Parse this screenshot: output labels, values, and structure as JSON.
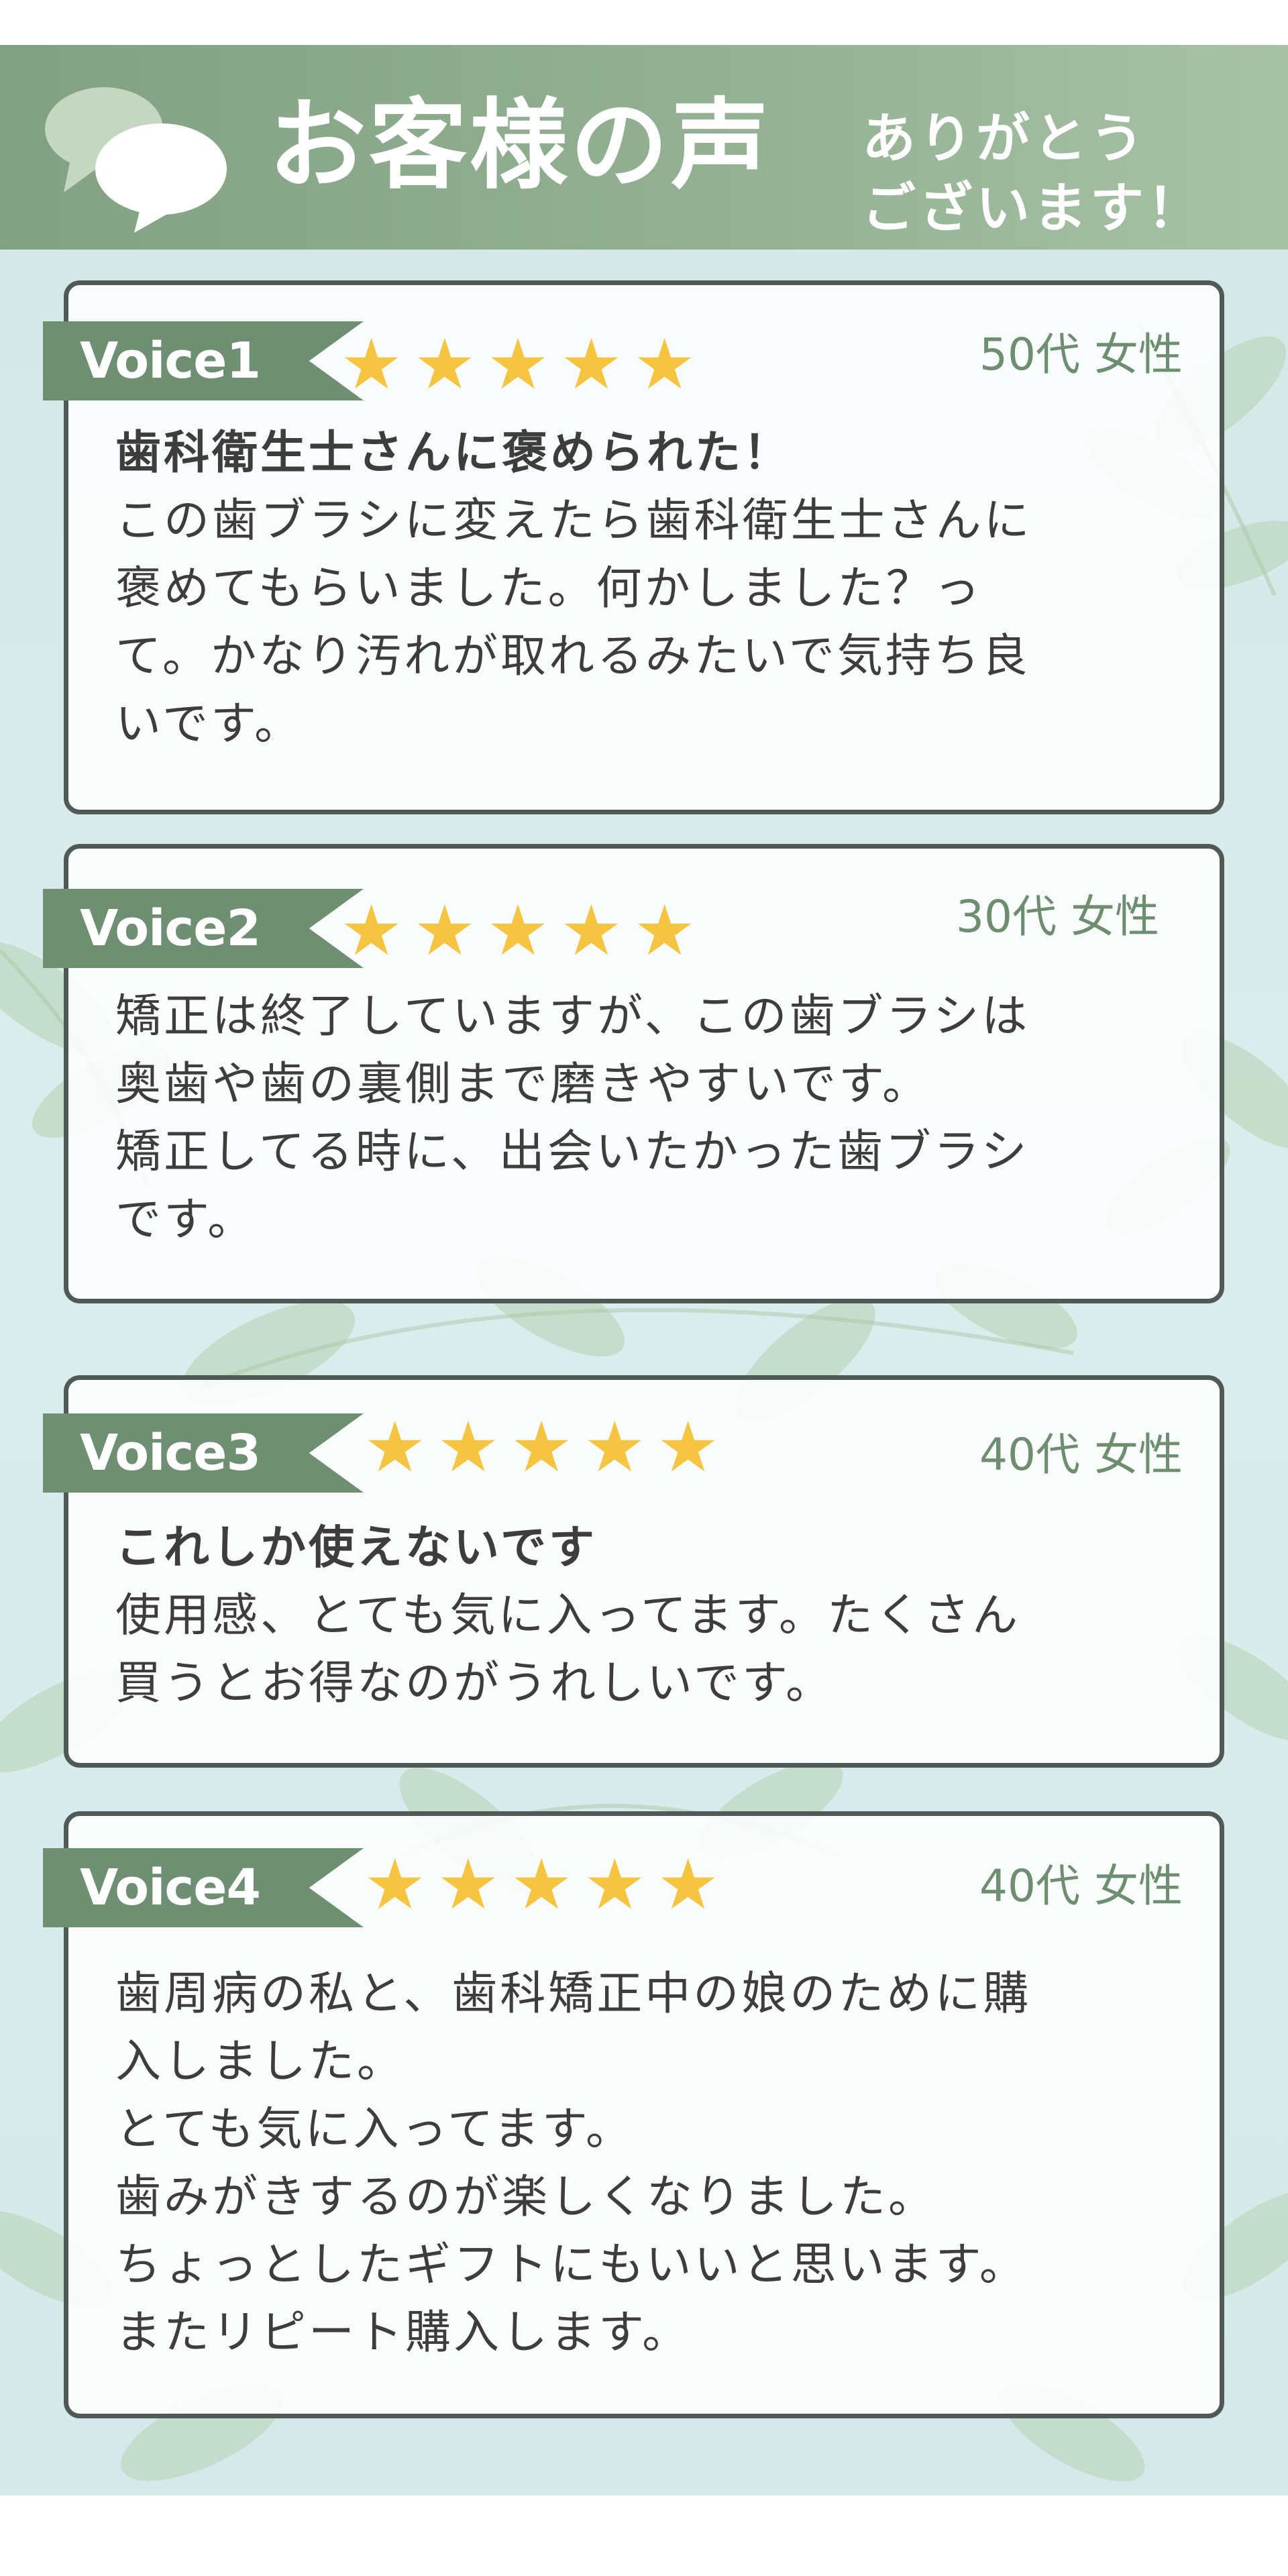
{
  "header": {
    "title": "お客様の声",
    "thanks_line1": "ありがとう",
    "thanks_line2": "ございます！",
    "icon": "speech-bubbles-icon"
  },
  "colors": {
    "header_green": "#86a487",
    "tag_green": "#6f8f72",
    "star_yellow": "#f5c542",
    "age_green": "#6d8f70",
    "card_border": "#4f5a56",
    "background": "#d6e9ea"
  },
  "reviews": [
    {
      "tag": "Voice1",
      "rating": "★★★★★",
      "stars_value": 5,
      "age": "50代 女性",
      "title": "歯科衛生士さんに褒められた！",
      "lines": [
        "この歯ブラシに変えたら歯科衛生士さんに",
        "褒めてもらいました。何かしました？っ",
        "て。かなり汚れが取れるみたいで気持ち良",
        "いです。"
      ]
    },
    {
      "tag": "Voice2",
      "rating": "★★★★★",
      "stars_value": 5,
      "age": "30代 女性",
      "title": "",
      "lines": [
        "矯正は終了していますが、この歯ブラシは",
        "奥歯や歯の裏側まで磨きやすいです。",
        "矯正してる時に、出会いたかった歯ブラシ",
        "です。"
      ]
    },
    {
      "tag": "Voice3",
      "rating": "★★★★★",
      "stars_value": 5,
      "age": "40代 女性",
      "title": "これしか使えないです",
      "lines": [
        "使用感、とても気に入ってます。たくさん",
        "買うとお得なのがうれしいです。"
      ]
    },
    {
      "tag": "Voice4",
      "rating": "★★★★★",
      "stars_value": 5,
      "age": "40代 女性",
      "title": "",
      "lines": [
        "歯周病の私と、歯科矯正中の娘のために購",
        "入しました。",
        "とても気に入ってます。",
        "歯みがきするのが楽しくなりました。",
        "ちょっとしたギフトにもいいと思います。",
        "またリピート購入します。"
      ]
    }
  ]
}
